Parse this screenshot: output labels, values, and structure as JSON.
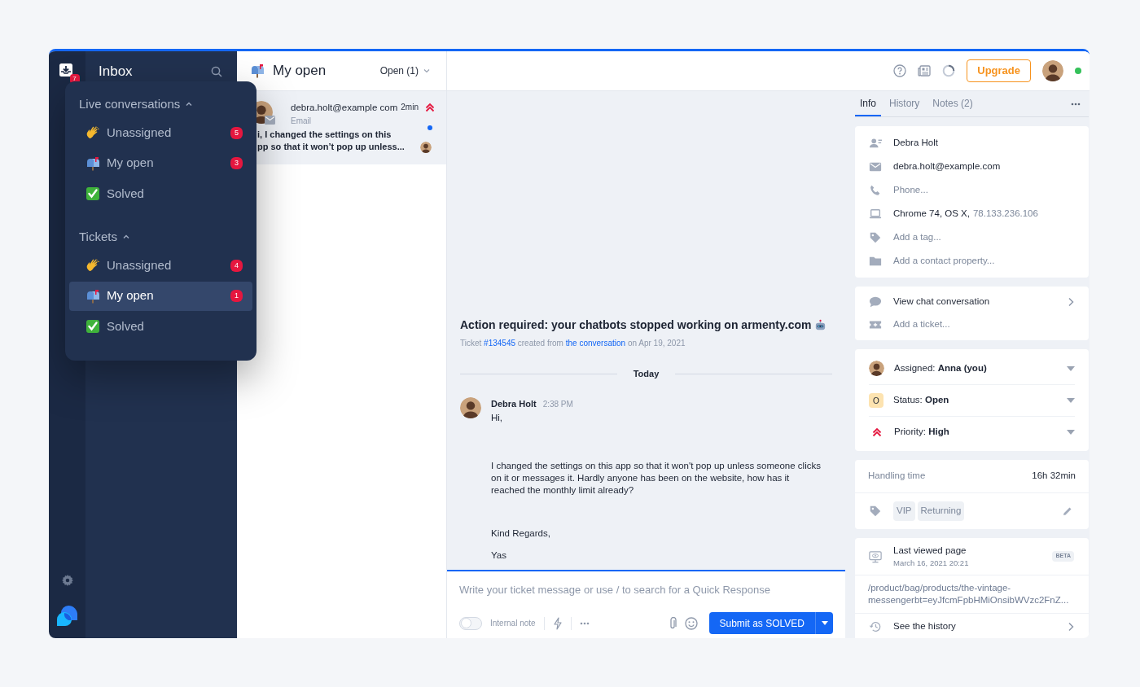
{
  "rail": {
    "inbox_badge": "7"
  },
  "inbox": {
    "title": "Inbox"
  },
  "menu": {
    "sections": [
      {
        "title": "Live conversations",
        "expanded": true,
        "items": [
          {
            "kind": "wave",
            "label": "Unassigned",
            "count": "5",
            "selected": false
          },
          {
            "kind": "mailbox",
            "label": "My open",
            "count": "3",
            "selected": false
          },
          {
            "kind": "check",
            "label": "Solved",
            "selected": false
          }
        ]
      },
      {
        "title": "Tickets",
        "expanded": true,
        "items": [
          {
            "kind": "wave",
            "label": "Unassigned",
            "count": "4",
            "selected": false
          },
          {
            "kind": "mailbox",
            "label": "My open",
            "count": "1",
            "selected": true
          },
          {
            "kind": "check",
            "label": "Solved",
            "selected": false
          }
        ]
      }
    ]
  },
  "conversation_list": {
    "title": "My open",
    "filter": "Open (1)",
    "items": [
      {
        "sender": "debra.holt@example com",
        "channel": "Email",
        "time": "2min",
        "high_priority": true,
        "unread": true,
        "preview": [
          "i, I changed the settings on this",
          "pp so that it won’t pop up unless..."
        ]
      }
    ]
  },
  "header": {
    "upgrade": "Upgrade",
    "online": true
  },
  "ticket": {
    "title": "Action required: your chatbots stopped working on armenty.com",
    "meta": {
      "prefix": "Ticket",
      "ticket": "#134545",
      "middle": "created from",
      "source": "the conversation",
      "suffix": "on Apr 19, 2021"
    },
    "divider": "Today",
    "message": {
      "author": "Debra Holt",
      "time": "2:38 PM",
      "paragraphs": [
        "Hi,",
        "I changed the settings on this app so that it won't pop up unless someone clicks on it or messages it. Hardly anyone has been on the website, how has it reached the monthly limit already?",
        "Kind Regards,",
        "Yas"
      ]
    }
  },
  "composer": {
    "placeholder": "Write your ticket message or use / to search for a Quick Response",
    "internal_note": "Internal note",
    "internal_note_on": false,
    "submit": "Submit as SOLVED"
  },
  "details": {
    "tabs": [
      {
        "label": "Info",
        "selected": true
      },
      {
        "label": "History",
        "selected": false
      },
      {
        "label": "Notes (2)",
        "selected": false
      }
    ],
    "contact": [
      {
        "kind": "person",
        "text": "Debra Holt",
        "placeholder": false
      },
      {
        "kind": "mail",
        "text": "debra.holt@example.com",
        "placeholder": false
      },
      {
        "kind": "phone",
        "text": "Phone...",
        "placeholder": true
      },
      {
        "kind": "laptop",
        "text": "Chrome 74, OS X,",
        "extra": "78.133.236.106",
        "placeholder": false
      },
      {
        "kind": "tag",
        "text": "Add a tag...",
        "placeholder": true
      },
      {
        "kind": "folder",
        "text": "Add a contact property...",
        "placeholder": true
      }
    ],
    "links": [
      {
        "kind": "chat",
        "text": "View chat conversation",
        "placeholder": false,
        "arrow": true
      },
      {
        "kind": "ticket",
        "text": "Add a ticket...",
        "placeholder": true,
        "arrow": false
      }
    ],
    "properties": [
      {
        "kind": "avatar",
        "label": "Assigned:",
        "value": "Anna (you)"
      },
      {
        "kind": "status",
        "badge": "O",
        "label": "Status:",
        "value": "Open"
      },
      {
        "kind": "priority",
        "label": "Priority:",
        "value": "High"
      }
    ],
    "handling": {
      "label": "Handling time",
      "value": "16h 32min",
      "tags": [
        "VIP",
        "Returning"
      ]
    },
    "last_viewed": {
      "title": "Last viewed page",
      "date": "March 16, 2021 20:21",
      "badge": "BETA",
      "url": [
        "/product/bag/products/the-vintage-",
        "messengerbt=eyJfcmFpbHMiOnsibWVzc2FnZ..."
      ],
      "history": "See the history"
    }
  }
}
